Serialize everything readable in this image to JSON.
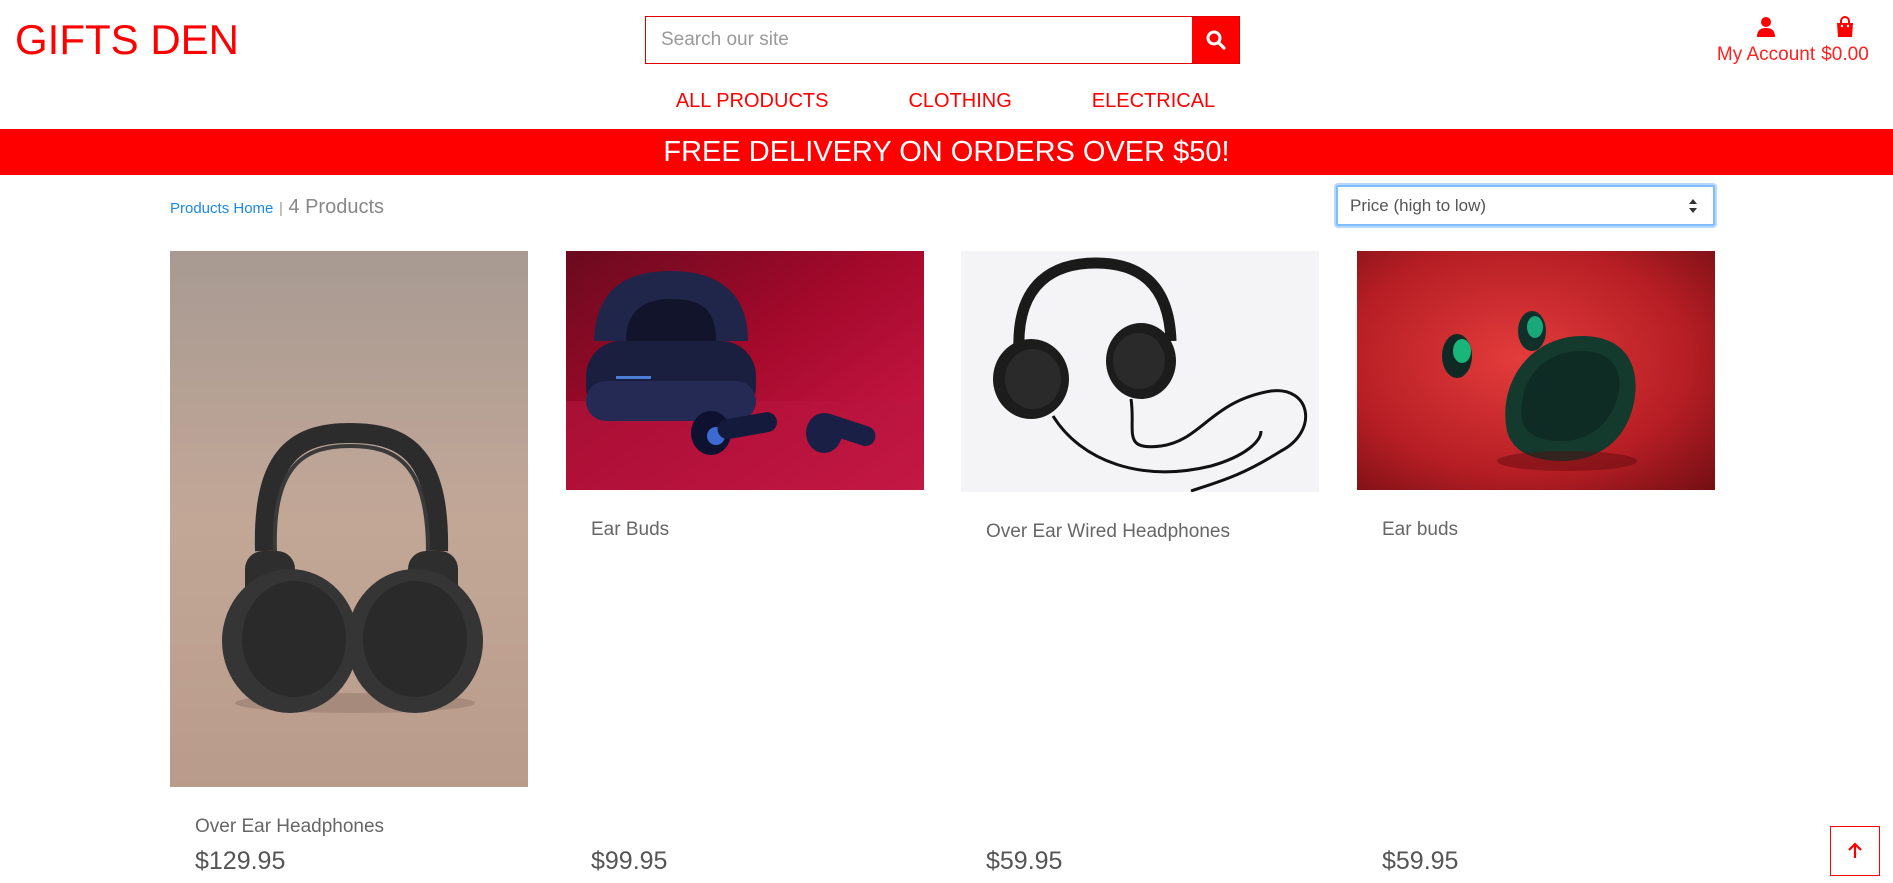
{
  "brand": "GIFTS DEN",
  "search": {
    "placeholder": "Search our site"
  },
  "account": {
    "label": "My Account"
  },
  "cart": {
    "total": "$0.00"
  },
  "nav": {
    "items": [
      "ALL PRODUCTS",
      "CLOTHING",
      "ELECTRICAL"
    ]
  },
  "banner": "FREE DELIVERY ON ORDERS OVER $50!",
  "breadcrumb": {
    "link": "Products Home",
    "separator": "|",
    "count": "4 Products"
  },
  "sort": {
    "selected": "Price (high to low)"
  },
  "products": [
    {
      "name": "Over Ear Headphones",
      "price": "$129.95"
    },
    {
      "name": "Ear Buds",
      "price": "$99.95"
    },
    {
      "name": "Over Ear Wired Headphones",
      "price": "$59.95"
    },
    {
      "name": "Ear buds",
      "price": "$59.95"
    }
  ],
  "colors": {
    "accent": "#ff0000",
    "link": "#1a88e6"
  },
  "icons": [
    "search-icon",
    "user-icon",
    "shopping-bag-icon",
    "sort-arrows-icon",
    "arrow-up-icon"
  ]
}
